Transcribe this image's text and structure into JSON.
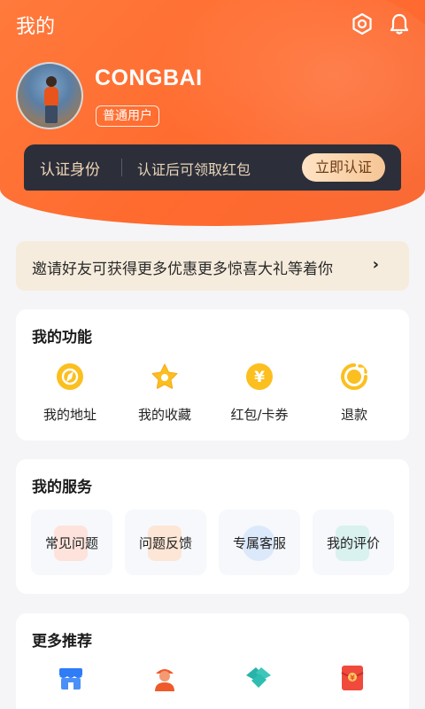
{
  "header": {
    "title": "我的",
    "username": "CONGBAI",
    "user_tag": "普通用户"
  },
  "verify": {
    "title": "认证身份",
    "desc": "认证后可领取红包",
    "button": "立即认证"
  },
  "invite": {
    "text": "邀请好友可获得更多优惠更多惊喜大礼等着你",
    "arrow": "›"
  },
  "functions": {
    "title": "我的功能",
    "items": [
      {
        "label": "我的地址",
        "icon": "compass-icon"
      },
      {
        "label": "我的收藏",
        "icon": "star-icon"
      },
      {
        "label": "红包/卡券",
        "icon": "yen-coupon-icon"
      },
      {
        "label": "退款",
        "icon": "refund-icon"
      }
    ]
  },
  "services": {
    "title": "我的服务",
    "items": [
      {
        "label": "常见问题"
      },
      {
        "label": "问题反馈"
      },
      {
        "label": "专属客服"
      },
      {
        "label": "我的评价"
      }
    ]
  },
  "more": {
    "title": "更多推荐",
    "icons": [
      "store-icon",
      "courier-icon",
      "handshake-icon",
      "red-packet-icon"
    ]
  },
  "colors": {
    "accent": "#ff6a2e",
    "gold": "#fbbf1f",
    "dark_bar": "#2c2f3a"
  }
}
